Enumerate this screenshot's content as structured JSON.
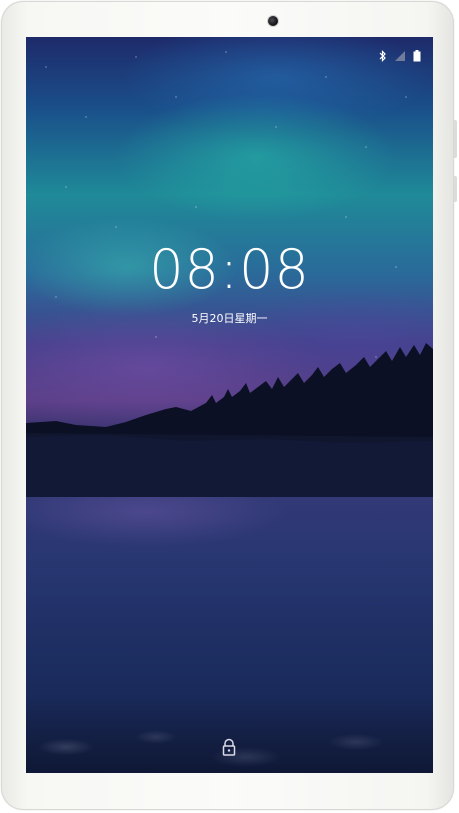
{
  "lockscreen": {
    "time": "08:08",
    "date": "5月20日星期一"
  },
  "status_bar": {
    "icons": [
      "bluetooth-icon",
      "signal-off-icon",
      "battery-icon"
    ]
  },
  "colors": {
    "text": "#ffffff",
    "device_frame": "#f7f7f4"
  }
}
